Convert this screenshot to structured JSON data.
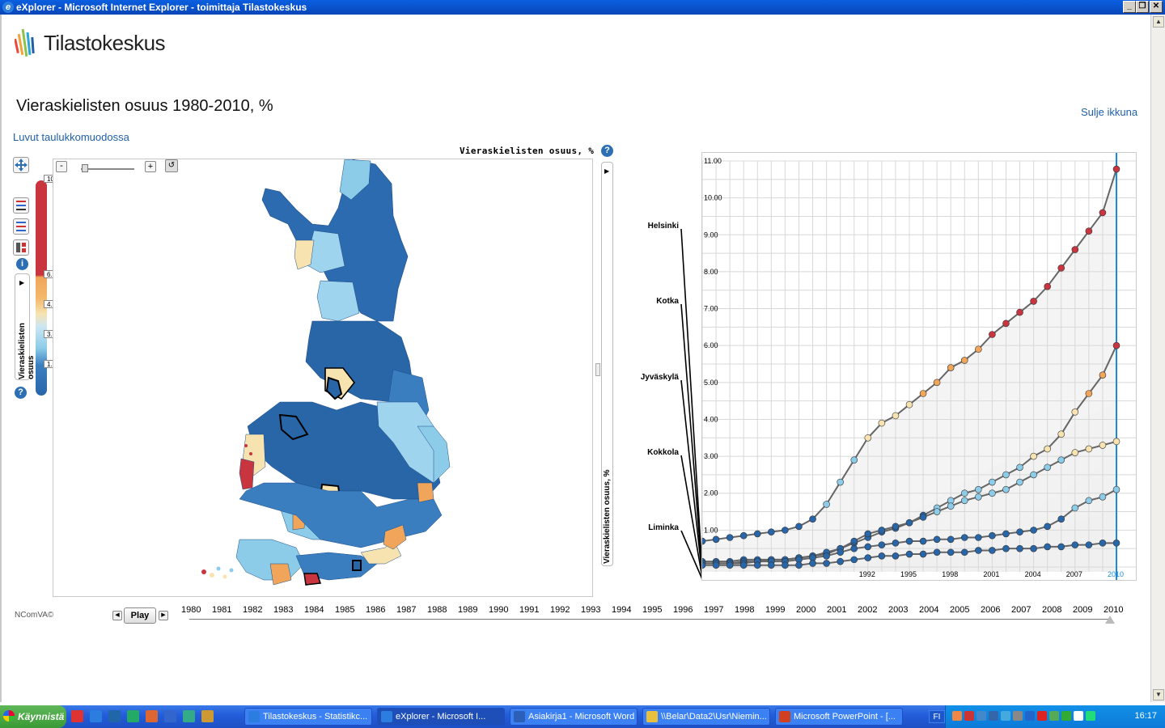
{
  "window": {
    "title": "eXplorer - Microsoft Internet Explorer - toimittaja Tilastokeskus",
    "btn_minimize": "_",
    "btn_restore": "❐",
    "btn_close": "✕"
  },
  "brand": {
    "name": "Tilastokeskus"
  },
  "page": {
    "title": "Vieraskielisten osuus 1980-2010, %",
    "table_link": "Luvut taulukkomuodossa",
    "close_link": "Sulje ikkuna",
    "credit": "NComVA©"
  },
  "map": {
    "title": "Vieraskielisten osuus, %",
    "zoom_minus": "-",
    "zoom_plus": "+",
    "legend_label": "Vieraskielisten osuus",
    "legend_ticks": [
      "10.78",
      "6.00",
      "4.50",
      "3.00",
      "1.50"
    ],
    "side_label": "Vieraskielisten osuus, %",
    "colors": {
      "high": "#c9353f",
      "midhigh": "#f0a55a",
      "mid": "#f7e3b0",
      "low": "#8ccce8",
      "lowest": "#2866a8"
    }
  },
  "chart_data": {
    "type": "line",
    "y_ticks": [
      "11.00",
      "10.00",
      "9.00",
      "8.00",
      "7.00",
      "6.00",
      "5.00",
      "4.00",
      "3.00",
      "2.00",
      "1.00"
    ],
    "x_ticks": [
      "1992",
      "1995",
      "1998",
      "2001",
      "2004",
      "2007",
      "2010"
    ],
    "ylim": [
      0,
      11
    ],
    "xlim": [
      1980,
      2010
    ],
    "current_year": "2010",
    "region_labels": [
      "Helsinki",
      "Kotka",
      "Jyväskylä",
      "Kokkola",
      "Liminka"
    ],
    "series": [
      {
        "name": "Helsinki",
        "values": [
          0.7,
          0.75,
          0.8,
          0.85,
          0.9,
          0.95,
          1.0,
          1.1,
          1.3,
          1.7,
          2.3,
          2.9,
          3.5,
          3.9,
          4.1,
          4.4,
          4.7,
          5.0,
          5.4,
          5.6,
          5.9,
          6.3,
          6.6,
          6.9,
          7.2,
          7.6,
          8.1,
          8.6,
          9.1,
          9.6,
          10.78
        ]
      },
      {
        "name": "Kotka",
        "values": [
          0.15,
          0.15,
          0.15,
          0.2,
          0.2,
          0.2,
          0.2,
          0.25,
          0.3,
          0.35,
          0.5,
          0.65,
          0.8,
          0.95,
          1.05,
          1.2,
          1.4,
          1.6,
          1.8,
          2.0,
          2.1,
          2.3,
          2.5,
          2.7,
          3.0,
          3.2,
          3.6,
          4.2,
          4.7,
          5.2,
          6.0
        ]
      },
      {
        "name": "Jyväskylä",
        "values": [
          0.1,
          0.1,
          0.1,
          0.15,
          0.15,
          0.2,
          0.2,
          0.25,
          0.3,
          0.4,
          0.5,
          0.7,
          0.9,
          1.0,
          1.1,
          1.2,
          1.35,
          1.5,
          1.65,
          1.8,
          1.9,
          2.0,
          2.1,
          2.3,
          2.5,
          2.7,
          2.9,
          3.1,
          3.2,
          3.3,
          3.4
        ]
      },
      {
        "name": "Kokkola",
        "values": [
          0.1,
          0.1,
          0.1,
          0.1,
          0.15,
          0.15,
          0.15,
          0.2,
          0.25,
          0.3,
          0.4,
          0.5,
          0.55,
          0.6,
          0.65,
          0.7,
          0.7,
          0.75,
          0.75,
          0.8,
          0.8,
          0.85,
          0.9,
          0.95,
          1.0,
          1.1,
          1.3,
          1.6,
          1.8,
          1.9,
          2.1
        ]
      },
      {
        "name": "Liminka",
        "values": [
          0.05,
          0.05,
          0.05,
          0.05,
          0.05,
          0.05,
          0.05,
          0.05,
          0.1,
          0.1,
          0.15,
          0.2,
          0.25,
          0.3,
          0.3,
          0.35,
          0.35,
          0.4,
          0.4,
          0.4,
          0.45,
          0.45,
          0.5,
          0.5,
          0.5,
          0.55,
          0.55,
          0.6,
          0.6,
          0.65,
          0.65
        ]
      }
    ]
  },
  "timeline": {
    "play_label": "Play",
    "years": [
      "1980",
      "1981",
      "1982",
      "1983",
      "1984",
      "1985",
      "1986",
      "1987",
      "1988",
      "1989",
      "1990",
      "1991",
      "1992",
      "1993",
      "1994",
      "1995",
      "1996",
      "1997",
      "1998",
      "1999",
      "2000",
      "2001",
      "2002",
      "2003",
      "2004",
      "2005",
      "2006",
      "2007",
      "2008",
      "2009",
      "2010"
    ]
  },
  "taskbar": {
    "start": "Käynnistä",
    "tasks": [
      {
        "label": "Tilastokeskus - Statistikc...",
        "color": "#2b7de0",
        "active": false
      },
      {
        "label": "eXplorer - Microsoft I...",
        "color": "#2b7de0",
        "active": true
      },
      {
        "label": "Asiakirja1 - Microsoft Word",
        "color": "#2b5fb8",
        "active": false
      },
      {
        "label": "\\\\Belar\\Data2\\Usr\\Niemin...",
        "color": "#e8c040",
        "active": false
      },
      {
        "label": "Microsoft PowerPoint - [...",
        "color": "#d04020",
        "active": false
      }
    ],
    "language": "FI",
    "clock": "16:17"
  }
}
